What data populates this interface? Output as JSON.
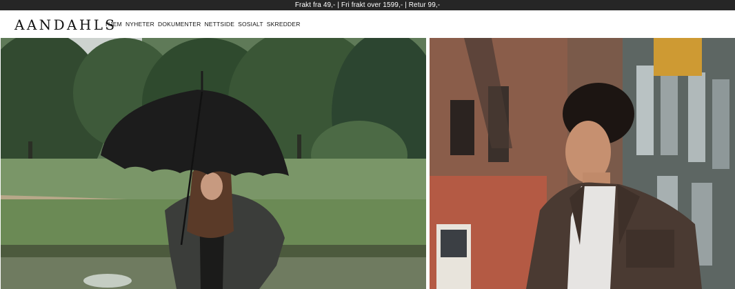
{
  "announcement": "Frakt fra 49,- | Fri frakt over 1599,- | Retur 99,-",
  "brand": {
    "logo_text": "AANDAHLS"
  },
  "nav": {
    "items": [
      "HJEM",
      "NYHETER",
      "DOKUMENTER",
      "NETTSIDE",
      "SOSIALT",
      "SKREDDER"
    ]
  },
  "hero": {
    "left_image": "woman-with-umbrella-in-park-photo",
    "right_image": "man-in-suede-jacket-city-street-photo"
  },
  "colors": {
    "topbar": "#262626",
    "text": "#111111",
    "background": "#ffffff"
  }
}
